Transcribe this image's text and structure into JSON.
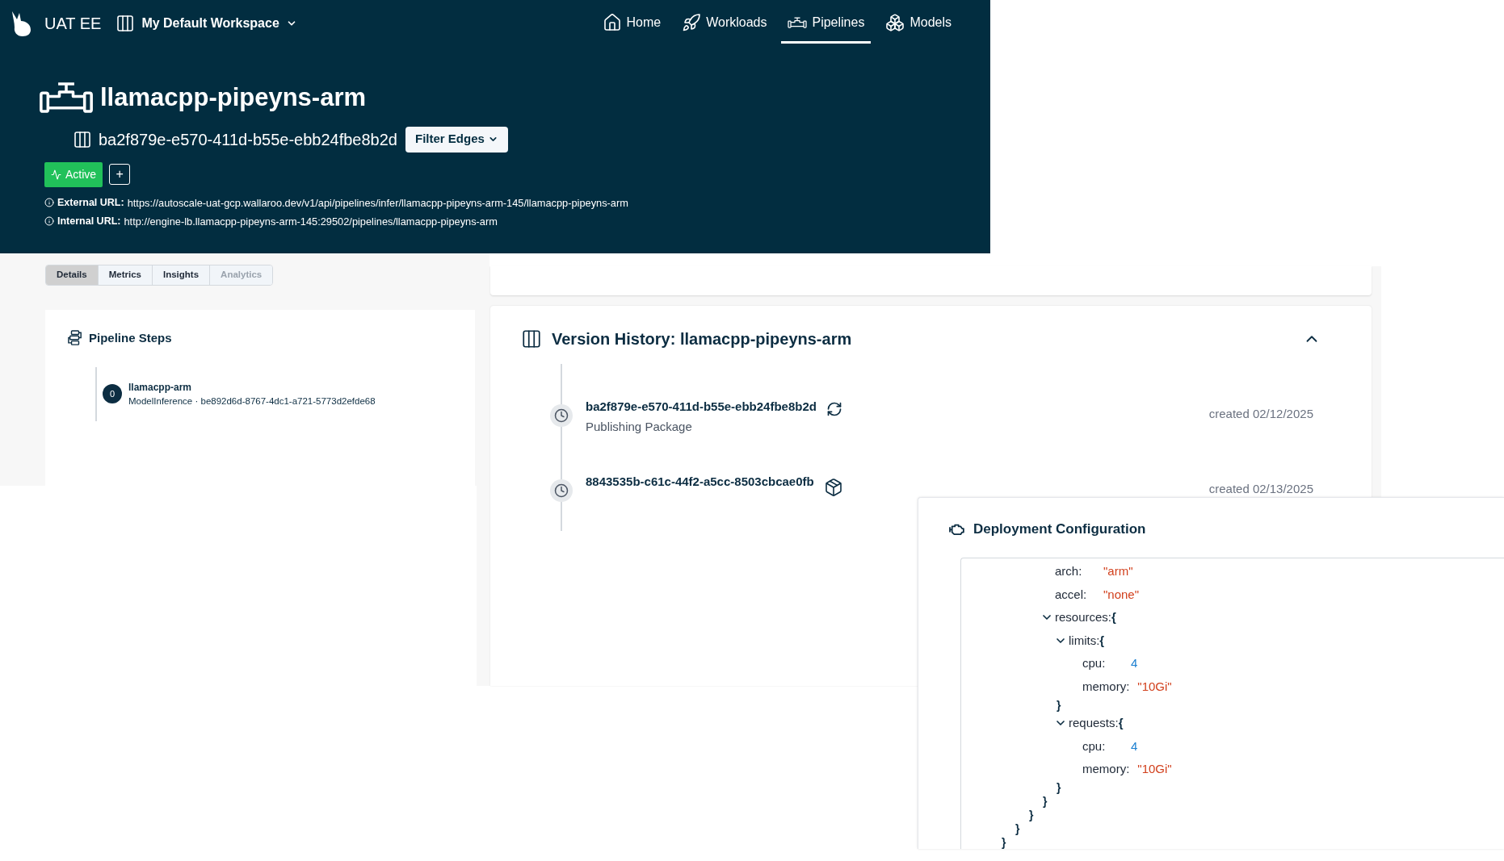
{
  "header": {
    "app_name": "UAT EE",
    "workspace": "My Default Workspace",
    "nav": [
      {
        "label": "Home",
        "kind": "home",
        "selected": false
      },
      {
        "label": "Workloads",
        "kind": "rocket",
        "selected": false
      },
      {
        "label": "Pipelines",
        "kind": "pipe",
        "selected": true
      },
      {
        "label": "Models",
        "kind": "cubes",
        "selected": false
      }
    ]
  },
  "pipeline": {
    "title": "llamacpp-pipeyns-arm",
    "version": "ba2f879e-e570-411d-b55e-ebb24fbe8b2d",
    "filter_button": "Filter Edges",
    "status": "Active",
    "status_active": true,
    "add_button": "+",
    "urls": [
      {
        "label": "External URL:",
        "value": "https://autoscale-uat-gcp.wallaroo.dev/v1/api/pipelines/infer/llamacpp-pipeyns-arm-145/llamacpp-pipeyns-arm"
      },
      {
        "label": "Internal URL:",
        "value": "http://engine-lb.llamacpp-pipeyns-arm-145:29502/pipelines/llamacpp-pipeyns-arm"
      }
    ]
  },
  "tabs": [
    {
      "label": "Details",
      "selected": true,
      "disabled": false
    },
    {
      "label": "Metrics",
      "selected": false,
      "disabled": false
    },
    {
      "label": "Insights",
      "selected": false,
      "disabled": false
    },
    {
      "label": "Analytics",
      "selected": false,
      "disabled": true
    }
  ],
  "pipeline_steps": {
    "title": "Pipeline Steps",
    "steps": [
      {
        "index": "0",
        "name": "llamacpp-arm",
        "detail": "ModelInference · be892d6d-8767-4dc1-a721-5773d2efde68"
      }
    ]
  },
  "version_history": {
    "title": "Version History: llamacpp-pipeyns-arm",
    "expanded": true,
    "versions": [
      {
        "id": "ba2f879e-e570-411d-b55e-ebb24fbe8b2d",
        "status": "Publishing Package",
        "kind": "refresh",
        "created": "created 02/12/2025"
      },
      {
        "id": "8843535b-c61c-44f2-a5cc-8503cbcae0fb",
        "kind": "package",
        "created": "created 02/13/2025"
      }
    ]
  },
  "deployment_configuration": {
    "title": "Deployment Configuration",
    "tree": [
      {
        "kind": "scope",
        "close": "}",
        "children": [
          {
            "kind": "scope",
            "close": "}",
            "children": [
              {
                "kind": "scope",
                "close": "}",
                "children": [
                  {
                    "kind": "string",
                    "key": "arch:",
                    "value": "\"arm\""
                  },
                  {
                    "kind": "string",
                    "key": "accel:",
                    "value": "\"none\""
                  },
                  {
                    "kind": "object",
                    "key": "resources:",
                    "open": "{",
                    "close": "}",
                    "expanded": true,
                    "children": [
                      {
                        "kind": "object",
                        "key": "limits:",
                        "open": "{",
                        "close": "}",
                        "expanded": true,
                        "children": [
                          {
                            "kind": "number",
                            "key": "cpu:",
                            "value": "4"
                          },
                          {
                            "kind": "string",
                            "key": "memory:",
                            "value": "\"10Gi\""
                          }
                        ]
                      },
                      {
                        "kind": "object",
                        "key": "requests:",
                        "open": "{",
                        "close": "}",
                        "expanded": true,
                        "children": [
                          {
                            "kind": "number",
                            "key": "cpu:",
                            "value": "4"
                          },
                          {
                            "kind": "string",
                            "key": "memory:",
                            "value": "\"10Gi\""
                          }
                        ]
                      }
                    ]
                  }
                ]
              }
            ]
          }
        ]
      }
    ]
  }
}
